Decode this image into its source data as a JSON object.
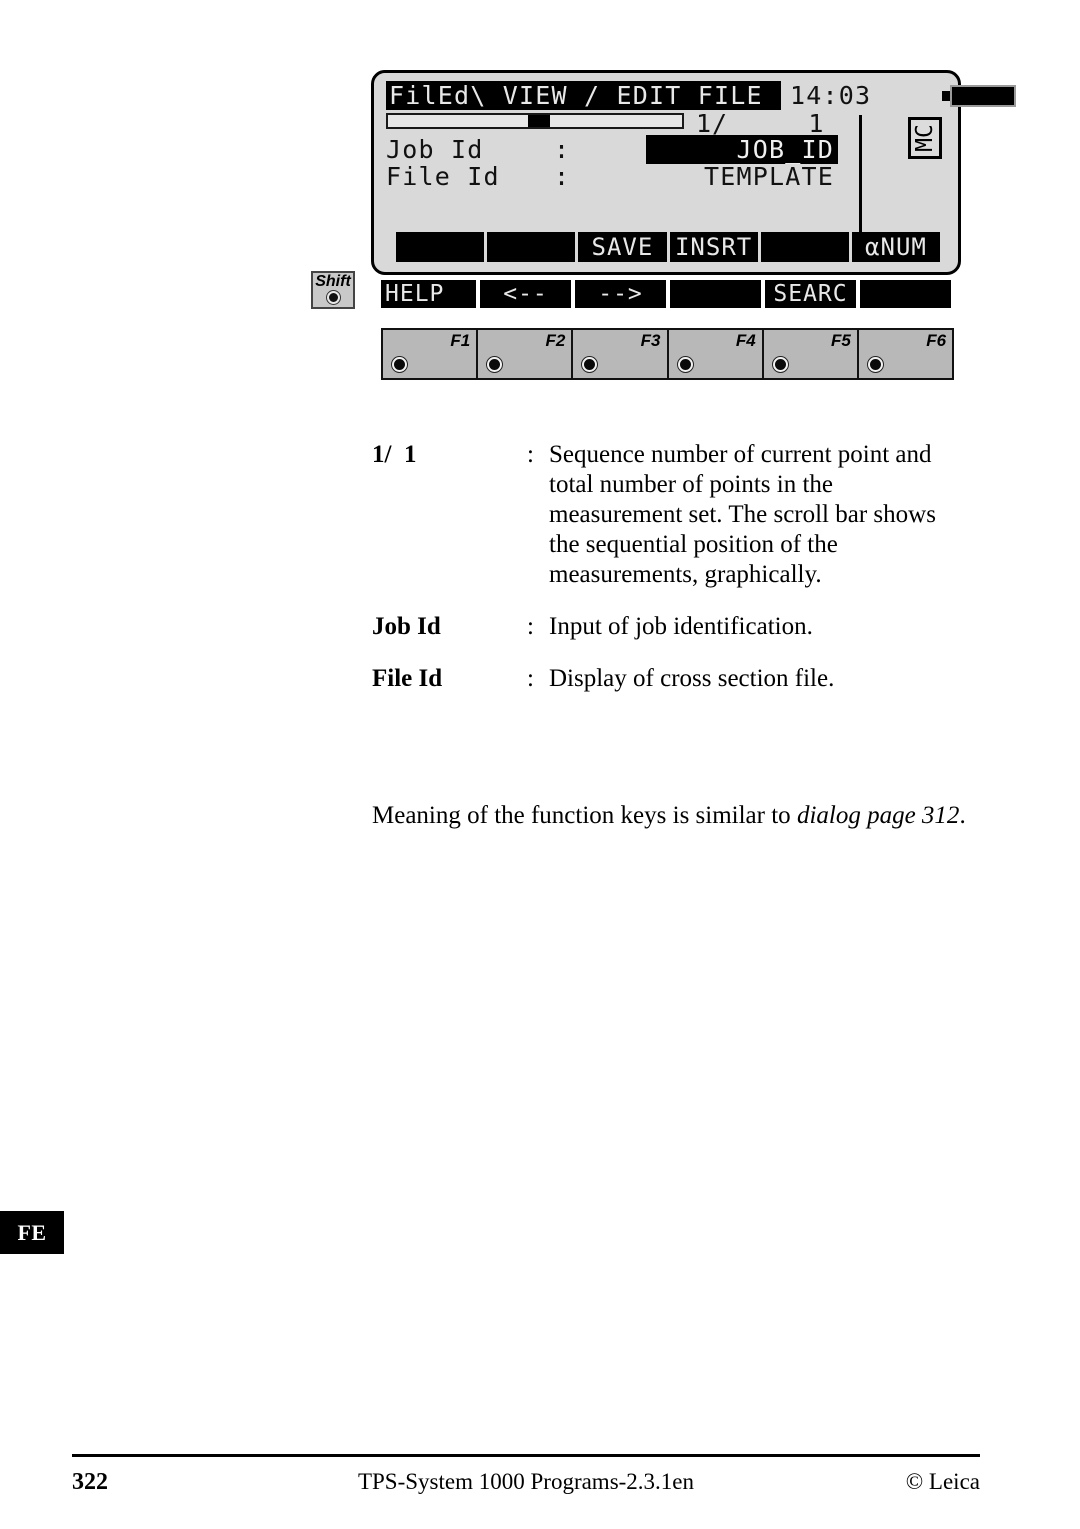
{
  "device": {
    "screen": {
      "title": "FilEd\\ VIEW / EDIT FILE",
      "clock": "14:03",
      "battery_icon": "battery-icon",
      "sequence": "1/     1",
      "scrollbar": {
        "thumb_position_percent": 47
      },
      "fields": [
        {
          "label": "Job Id",
          "colon": ":",
          "value": "JOB_ID",
          "highlighted": true
        },
        {
          "label": "File Id",
          "colon": ":",
          "value": "TEMPLATE",
          "highlighted": false
        }
      ],
      "mode_badge": "MC",
      "softkeys": [
        "",
        "",
        "SAVE",
        "INSRT",
        "",
        "αNUM"
      ]
    },
    "shift_key": {
      "label": "Shift"
    },
    "shift_softkeys": [
      "HELP",
      "<--",
      "-->",
      "",
      "SEARC",
      ""
    ],
    "function_keys": [
      "F1",
      "F2",
      "F3",
      "F4",
      "F5",
      "F6"
    ]
  },
  "definitions": [
    {
      "term": "1/  1",
      "colon": ":",
      "description": "Sequence number of current point and total number of points in the measurement set. The scroll bar shows the sequential position of the measurements, graphically."
    },
    {
      "term": "Job Id",
      "colon": ":",
      "description": "Input of job identification."
    },
    {
      "term": "File Id",
      "colon": ":",
      "description": "Display of cross section file."
    }
  ],
  "paragraph": {
    "lead": "Meaning of the function keys is similar to ",
    "emphasis": "dialog page 312",
    "tail": "."
  },
  "side_tab": "FE",
  "footer": {
    "page_number": "322",
    "doc_title": "TPS-System 1000 Programs-2.3.1en",
    "copyright": "© Leica"
  }
}
